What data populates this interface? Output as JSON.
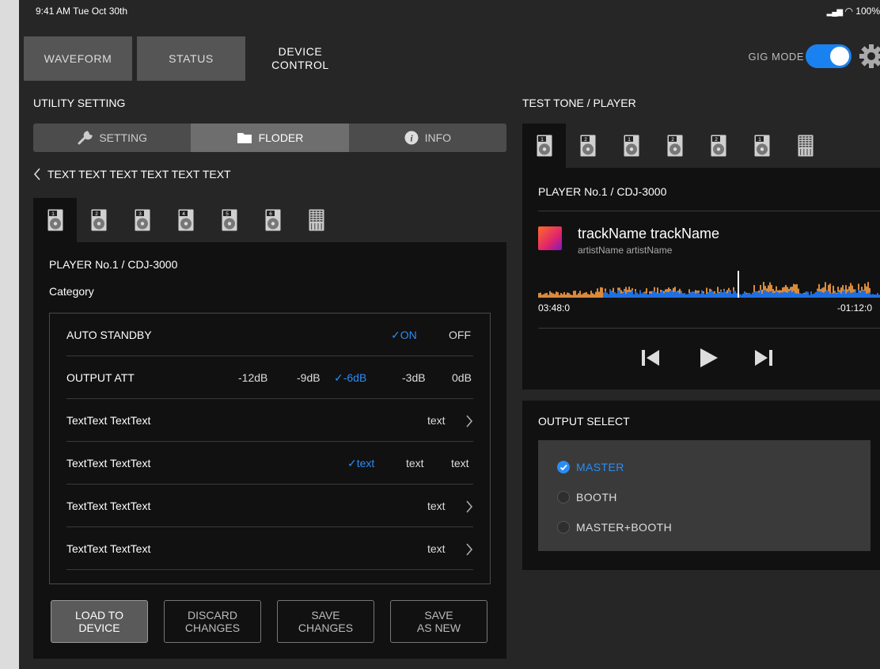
{
  "status_bar": {
    "time": "9:41 AM  Tue Oct 30th",
    "battery": "100%"
  },
  "top_tabs": [
    {
      "label": "WAVEFORM",
      "active": false
    },
    {
      "label": "STATUS",
      "active": false
    },
    {
      "label": "DEVICE\nCONTROL",
      "active": true
    }
  ],
  "gig_mode": {
    "label": "GIG MODE",
    "on": true
  },
  "utility": {
    "title": "UTILITY SETTING",
    "subtabs": [
      {
        "label": "SETTING",
        "icon": "wrench-icon",
        "active": false
      },
      {
        "label": "FLODER",
        "icon": "folder-icon",
        "active": true
      },
      {
        "label": "INFO",
        "icon": "info-icon",
        "active": false
      }
    ],
    "back_text": "TEXT TEXT TEXT TEXT TEXT TEXT",
    "devices": [
      "1",
      "2",
      "3",
      "4",
      "5",
      "6",
      "mixer"
    ],
    "player_label": "PLAYER No.1 / CDJ-3000",
    "category_label": "Category",
    "rows": [
      {
        "label": "AUTO STANDBY",
        "options": [
          "ON",
          "OFF"
        ],
        "selected": 0
      },
      {
        "label": "OUTPUT ATT",
        "options": [
          "-12dB",
          "-9dB",
          "-6dB",
          "-3dB",
          "0dB"
        ],
        "selected": 2
      },
      {
        "label": "TextText TextText",
        "value": "text"
      },
      {
        "label": "TextText TextText",
        "options": [
          "text",
          "text",
          "text"
        ],
        "selected": 0
      },
      {
        "label": "TextText TextText",
        "value": "text"
      },
      {
        "label": "TextText TextText",
        "value": "text"
      }
    ],
    "buttons": [
      {
        "label": "LOAD TO\nDEVICE",
        "primary": true
      },
      {
        "label": "DISCARD\nCHANGES",
        "primary": false
      },
      {
        "label": "SAVE\nCHANGES",
        "primary": false
      },
      {
        "label": "SAVE\nAS NEW",
        "primary": false
      }
    ]
  },
  "test_tone": {
    "title": "TEST TONE / PLAYER",
    "devices": [
      "1",
      "2",
      "1",
      "2",
      "2",
      "1",
      "mixer"
    ],
    "player_label": "PLAYER No.1 / CDJ-3000",
    "track_name": "trackName trackName",
    "artist_name": "artistName artistName",
    "time_elapsed": "03:48:0",
    "time_remaining": "-01:12:0"
  },
  "output_select": {
    "title": "OUTPUT SELECT",
    "options": [
      "MASTER",
      "BOOTH",
      "MASTER+BOOTH"
    ],
    "selected": 0
  },
  "colors": {
    "accent": "#2a8cf5",
    "toggle": "#1a82f0",
    "wave_blue": "#1f6fe0",
    "wave_orange": "#d98a3a"
  }
}
